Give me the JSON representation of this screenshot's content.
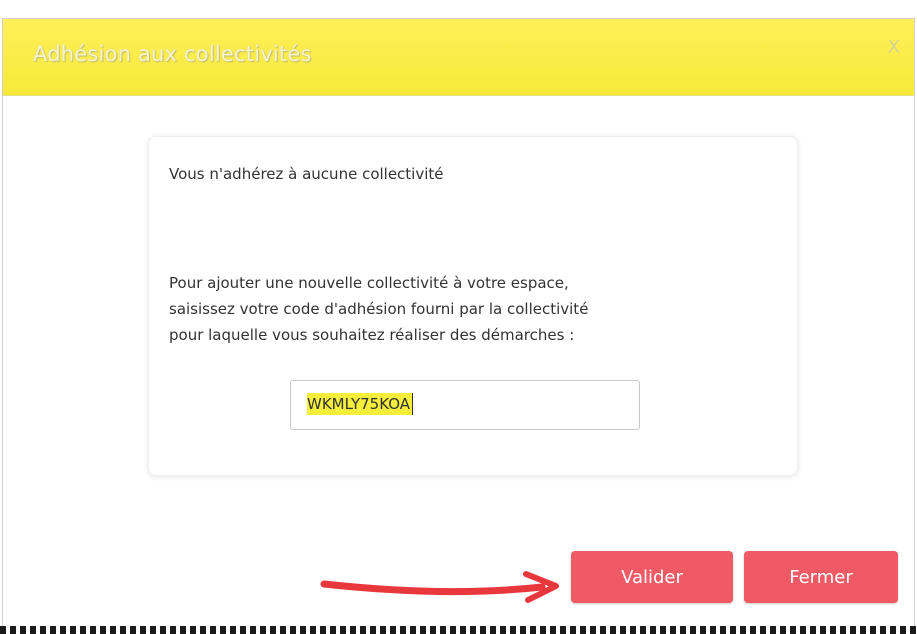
{
  "dialog": {
    "title": "Adhésion aux collectivités",
    "close_label": "X"
  },
  "content": {
    "message": "Vous n'adhérez à aucune collectivité",
    "instructions": [
      "Pour ajouter une nouvelle collectivité à votre espace,",
      "saisissez votre code d'adhésion fourni par la collectivité",
      "pour laquelle vous souhaitez réaliser des démarches :"
    ],
    "code_value": "WKMLY75KOA"
  },
  "buttons": {
    "validate_label": "Valider",
    "close_label": "Fermer"
  },
  "colors": {
    "title_bar": "#f6ea38",
    "button": "#ef5a64",
    "highlight": "#f5ee3a",
    "arrow": "#e8373d"
  },
  "icons": {
    "annotation": "red-arrow-icon"
  }
}
